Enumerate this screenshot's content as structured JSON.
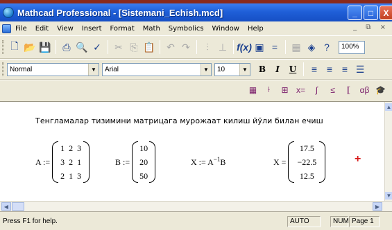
{
  "window": {
    "title": "Mathcad Professional - [Sistemani_Echish.mcd]",
    "controls": {
      "minimize": "_",
      "maximize": "□",
      "close": "X"
    }
  },
  "menu": {
    "items": [
      "File",
      "Edit",
      "View",
      "Insert",
      "Format",
      "Math",
      "Symbolics",
      "Window",
      "Help"
    ],
    "doc_controls": "_ ⧉ ×"
  },
  "toolbar_standard": {
    "buttons": [
      "new-icon",
      "open-icon",
      "save-icon",
      "print-icon",
      "print-preview-icon",
      "spell-check-icon",
      "cut-icon",
      "copy-icon",
      "paste-icon",
      "undo-icon",
      "redo-icon",
      "align-across-icon",
      "align-down-icon",
      "evaluate-icon",
      "insert-function-icon",
      "insert-unit-icon",
      "insert-component-icon",
      "resource-icon",
      "help-icon"
    ],
    "zoom": "100%"
  },
  "toolbar_format": {
    "style": "Normal",
    "font": "Arial",
    "size": "10",
    "bold": "B",
    "italic": "I",
    "underline": "U"
  },
  "toolbar_math": {
    "buttons": [
      "calculator-icon",
      "graph-icon",
      "matrix-icon",
      "evaluation-icon",
      "calculus-icon",
      "boolean-icon",
      "programming-icon",
      "greek-icon",
      "symbolic-icon"
    ]
  },
  "worksheet": {
    "heading": "Тенгламалар тизимини матрицага мурожаат килиш йўли билан ечиш",
    "A": {
      "label": "A :=",
      "rows": [
        [
          "1",
          "2",
          "3"
        ],
        [
          "3",
          "2",
          "1"
        ],
        [
          "2",
          "1",
          "3"
        ]
      ]
    },
    "B": {
      "label": "B :=",
      "rows": [
        [
          "10"
        ],
        [
          "20"
        ],
        [
          "50"
        ]
      ]
    },
    "X_def": {
      "lhs": "X := A",
      "exp": "−1",
      "rhs": "B"
    },
    "X_res": {
      "label": "X =",
      "rows": [
        [
          "17.5"
        ],
        [
          "−22.5"
        ],
        [
          "12.5"
        ]
      ]
    },
    "cursor": "+"
  },
  "status": {
    "help_text": "Press F1 for help.",
    "mode": "AUTO",
    "num": "NUM",
    "page": "Page 1"
  }
}
